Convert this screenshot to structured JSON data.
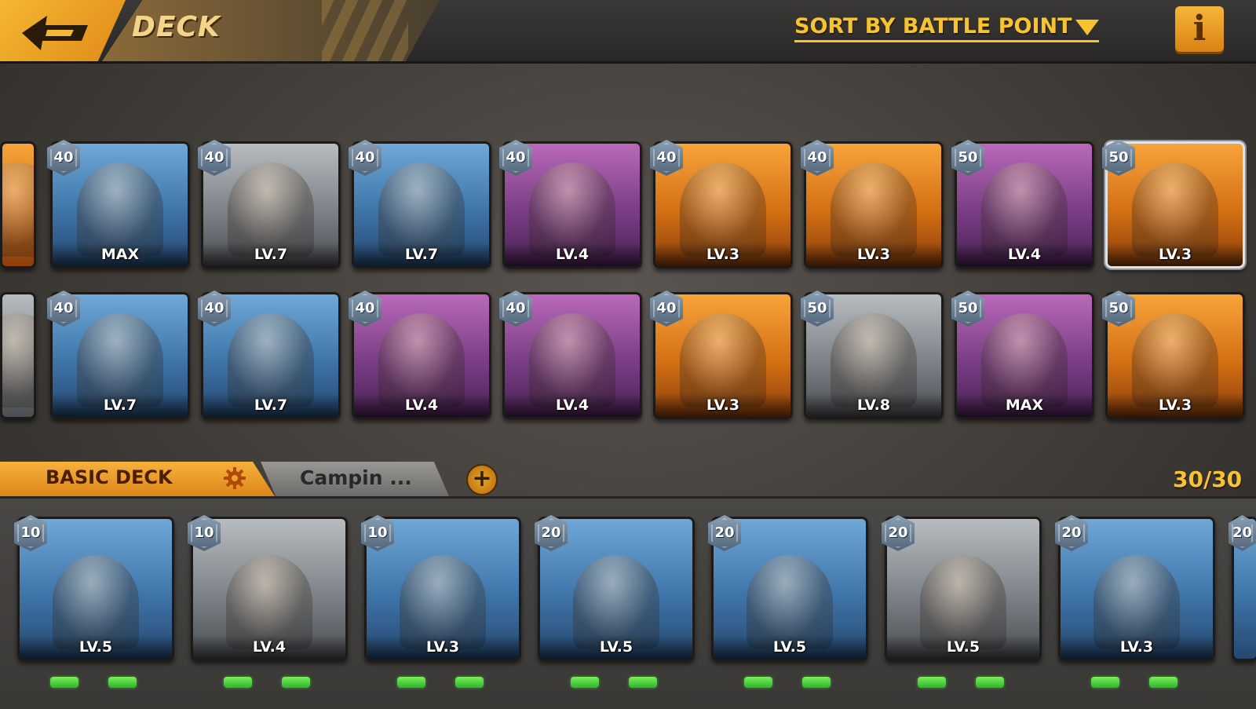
{
  "header": {
    "title": "DECK",
    "sort_label": "SORT BY BATTLE POINT",
    "info_label": "i"
  },
  "collection": {
    "row1": [
      {
        "cost": "40",
        "level": "MAX"
      },
      {
        "cost": "40",
        "level": "LV.7"
      },
      {
        "cost": "40",
        "level": "LV.7"
      },
      {
        "cost": "40",
        "level": "LV.4"
      },
      {
        "cost": "40",
        "level": "LV.3"
      },
      {
        "cost": "40",
        "level": "LV.3"
      },
      {
        "cost": "50",
        "level": "LV.4"
      },
      {
        "cost": "50",
        "level": "LV.3"
      }
    ],
    "row2": [
      {
        "cost": "40",
        "level": "LV.7"
      },
      {
        "cost": "40",
        "level": "LV.7"
      },
      {
        "cost": "40",
        "level": "LV.4"
      },
      {
        "cost": "40",
        "level": "LV.4"
      },
      {
        "cost": "40",
        "level": "LV.3"
      },
      {
        "cost": "50",
        "level": "LV.8"
      },
      {
        "cost": "50",
        "level": "MAX"
      },
      {
        "cost": "50",
        "level": "LV.3"
      }
    ]
  },
  "tabs": {
    "basic": "BASIC DECK",
    "campaign": "Campin ...",
    "add": "+",
    "count": "30/30"
  },
  "deck": [
    {
      "cost": "10",
      "level": "LV.5"
    },
    {
      "cost": "10",
      "level": "LV.4"
    },
    {
      "cost": "10",
      "level": "LV.3"
    },
    {
      "cost": "20",
      "level": "LV.5"
    },
    {
      "cost": "20",
      "level": "LV.5"
    },
    {
      "cost": "20",
      "level": "LV.5"
    },
    {
      "cost": "20",
      "level": "LV.3"
    },
    {
      "cost": "20",
      "level": ""
    }
  ],
  "colors": {
    "accent": "#f7c430",
    "tab_active": "#f6b13c",
    "pip": "#3dd038"
  }
}
